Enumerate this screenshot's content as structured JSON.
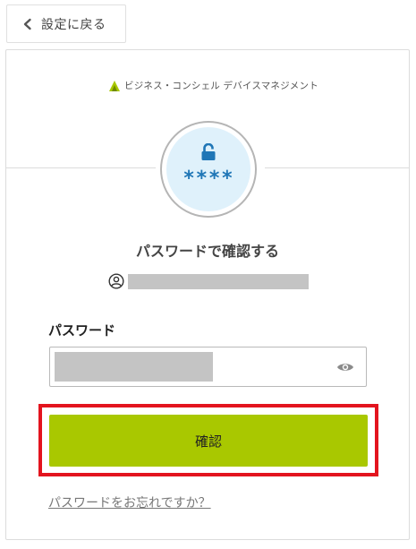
{
  "back_button": {
    "label": "設定に戻る",
    "icon": "chevron-left-icon"
  },
  "brand": {
    "name": "ビジネス・コンシェル デバイスマネジメント",
    "logo": "brand-logo",
    "color": "#a9c800"
  },
  "hero": {
    "icon": "unlock-icon",
    "stars": "****",
    "accent": "#1f76b6",
    "bg": "#dff1fb"
  },
  "title": "パスワードで確認する",
  "user": {
    "icon": "user-circle-icon"
  },
  "password": {
    "label": "パスワード",
    "toggle_icon": "eye-icon"
  },
  "confirm": {
    "label": "確認",
    "color": "#a9c800",
    "highlight_color": "#e3141e"
  },
  "forgot_link": "パスワードをお忘れですか？"
}
